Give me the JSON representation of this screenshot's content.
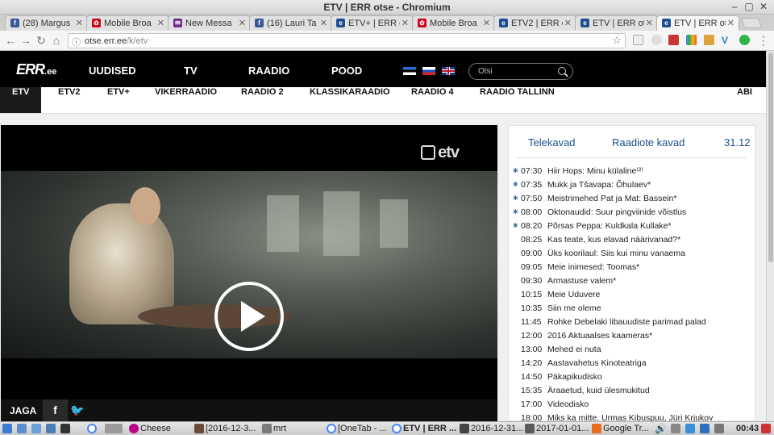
{
  "window": {
    "title": "ETV | ERR otse - Chromium"
  },
  "tabs": [
    {
      "label": "(28) Margus",
      "icon": "facebook-icon",
      "color": "#3b5998",
      "glyph": "f"
    },
    {
      "label": "Mobile Broa",
      "icon": "huawei-icon",
      "color": "#d0021b",
      "glyph": "✿"
    },
    {
      "label": "New Messa",
      "icon": "mail-icon",
      "color": "#6b2d8a",
      "glyph": "✉"
    },
    {
      "label": "(16) Lauri Ta",
      "icon": "facebook-icon",
      "color": "#3b5998",
      "glyph": "f"
    },
    {
      "label": "ETV+ | ERR o",
      "icon": "err-icon",
      "color": "#1d4f91",
      "glyph": "e"
    },
    {
      "label": "Mobile Broa",
      "icon": "huawei-icon",
      "color": "#d0021b",
      "glyph": "✿"
    },
    {
      "label": "ETV2 | ERR o",
      "icon": "err-icon",
      "color": "#1d4f91",
      "glyph": "e"
    },
    {
      "label": "ETV | ERR ot",
      "icon": "err-icon",
      "color": "#1d4f91",
      "glyph": "e"
    },
    {
      "label": "ETV | ERR ot",
      "icon": "err-icon",
      "color": "#1d4f91",
      "glyph": "e"
    }
  ],
  "address": {
    "url_host": "otse.err.ee",
    "url_path": "/k/etv"
  },
  "site": {
    "logo": "ERR",
    "logo_suffix": ".ee",
    "main_nav": [
      "UUDISED",
      "TV",
      "RAADIO",
      "POOD"
    ],
    "search_placeholder": "Otsi",
    "channels": [
      "ETV",
      "ETV2",
      "ETV+",
      "VIKERRAADIO",
      "RAADIO 2",
      "KLASSIKARAADIO",
      "RAADIO 4",
      "RAADIO TALLINN"
    ],
    "help": "ABI"
  },
  "player": {
    "channel_logo": "etv",
    "share_label": "JAGA",
    "facebook": "f",
    "twitter": "🐦"
  },
  "schedule": {
    "tabs": [
      "Telekavad",
      "Raadiote kavad",
      "31.12"
    ],
    "items": [
      {
        "time": "07:30",
        "title": "Hiir Hops: Minu külaline⁽²⁾",
        "rerun": true
      },
      {
        "time": "07:35",
        "title": "Mukk ja Tšavapa: Õhulaev*",
        "rerun": true
      },
      {
        "time": "07:50",
        "title": "Meistrimehed Pat ja Mat: Bassein*",
        "rerun": true
      },
      {
        "time": "08:00",
        "title": "Oktonaudid: Suur pingviinide võistlus",
        "rerun": true
      },
      {
        "time": "08:20",
        "title": "Põrsas Peppa: Kuldkala Kullake*",
        "rerun": true
      },
      {
        "time": "08:25",
        "title": "Kas teate, kus elavad näärivanad?*",
        "rerun": false
      },
      {
        "time": "09:00",
        "title": "Üks koorilaul: Siis kui minu vanaema",
        "rerun": false
      },
      {
        "time": "09:05",
        "title": "Meie inimesed: Toomas*",
        "rerun": false
      },
      {
        "time": "09:30",
        "title": "Armastuse valem*",
        "rerun": false
      },
      {
        "time": "10:15",
        "title": "Meie Uduvere",
        "rerun": false
      },
      {
        "time": "10:35",
        "title": "Siin me oleme",
        "rerun": false
      },
      {
        "time": "11:45",
        "title": "Rohke Debelaki libauudiste parimad palad",
        "rerun": false
      },
      {
        "time": "12:00",
        "title": "2016 Aktuaalses kaameras*",
        "rerun": false
      },
      {
        "time": "13:00",
        "title": "Mehed ei nuta",
        "rerun": false
      },
      {
        "time": "14:20",
        "title": "Aastavahetus Kinoteatriga",
        "rerun": false
      },
      {
        "time": "14:50",
        "title": "Päkapikudisko",
        "rerun": false
      },
      {
        "time": "15:35",
        "title": "Äraaetud, kuid ülesmukitud",
        "rerun": false
      },
      {
        "time": "17:00",
        "title": "Videodisko",
        "rerun": false
      },
      {
        "time": "18:00",
        "title": "Miks ka mitte. Urmas Kibuspuu, Jüri Krjukov",
        "rerun": false
      }
    ]
  },
  "taskbar": {
    "windows": [
      "Cheese",
      "[2016-12-3...",
      "mrt",
      "[OneTab - ...",
      "ETV | ERR ...",
      "2016-12-31...",
      "2017-01-01...",
      "Google Tr..."
    ],
    "clock": "00:43"
  }
}
